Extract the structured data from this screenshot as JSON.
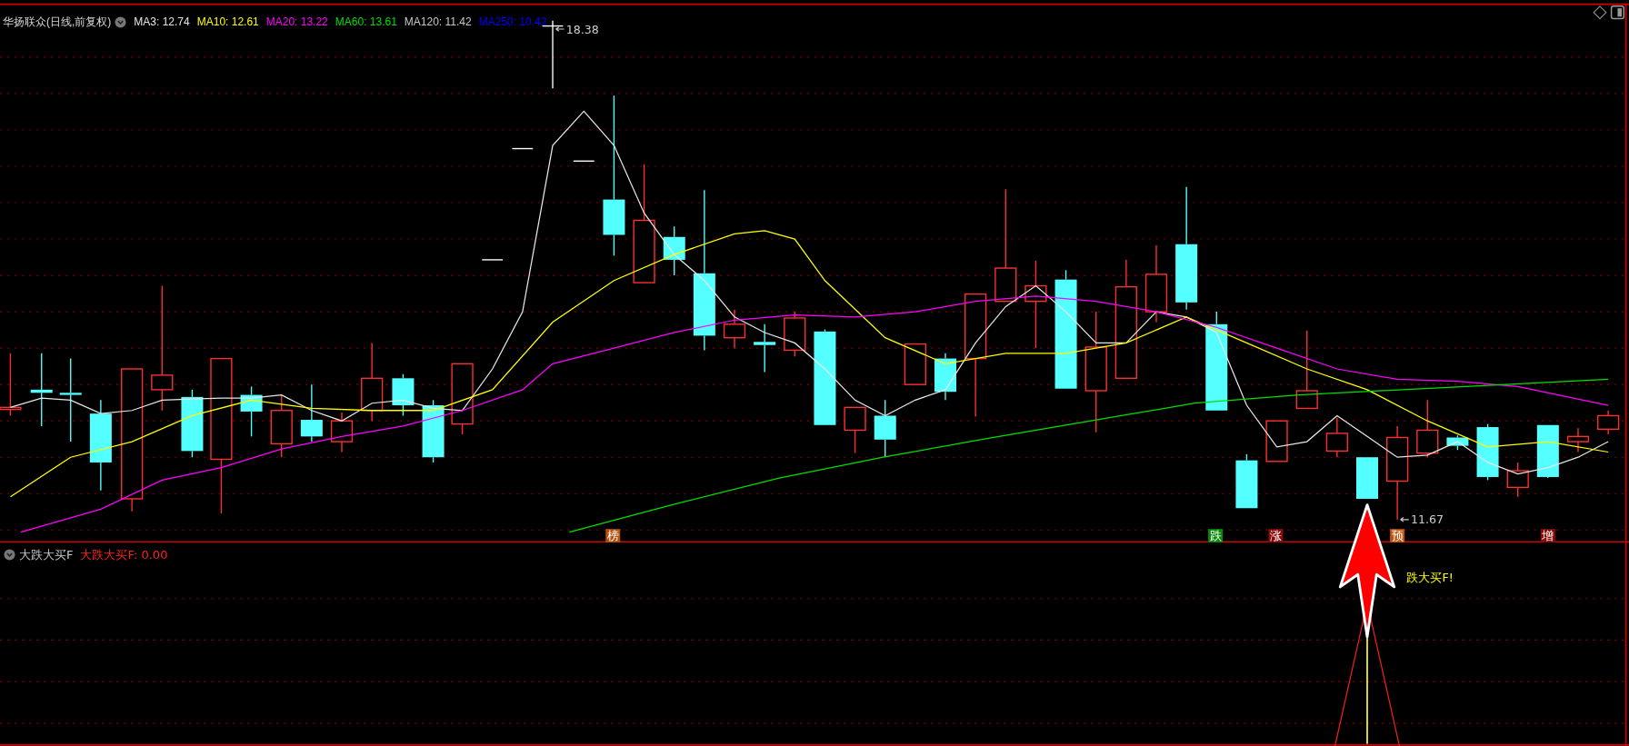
{
  "legend": {
    "title": "华扬联众(日线,前复权)",
    "indicators": [
      {
        "label": "MA3: 12.74",
        "color": "#e6e6e6"
      },
      {
        "label": "MA10: 12.61",
        "color": "#ffff00"
      },
      {
        "label": "MA20: 13.22",
        "color": "#ff00ff"
      },
      {
        "label": "MA60: 13.61",
        "color": "#00e000"
      },
      {
        "label": "MA120: 11.42",
        "color": "#c8c8c8"
      },
      {
        "label": "MA250: 10.42",
        "color": "#0000ff"
      }
    ]
  },
  "price_labels": [
    {
      "kind": "high",
      "text": "18.38"
    },
    {
      "kind": "low",
      "text": "11.67"
    }
  ],
  "signals": [
    {
      "text": "榜",
      "color": "#b5500c"
    },
    {
      "text": "跌",
      "color": "#0a8a0a"
    },
    {
      "text": "涨",
      "color": "#8a0a0a"
    },
    {
      "text": "预",
      "color": "#c0550a"
    },
    {
      "text": "增",
      "color": "#8a0a0a"
    }
  ],
  "indicator_pane": {
    "name": "大跌大买F",
    "reading": "大跌大买F: 0.00",
    "alert": "跌大买F!"
  }
}
